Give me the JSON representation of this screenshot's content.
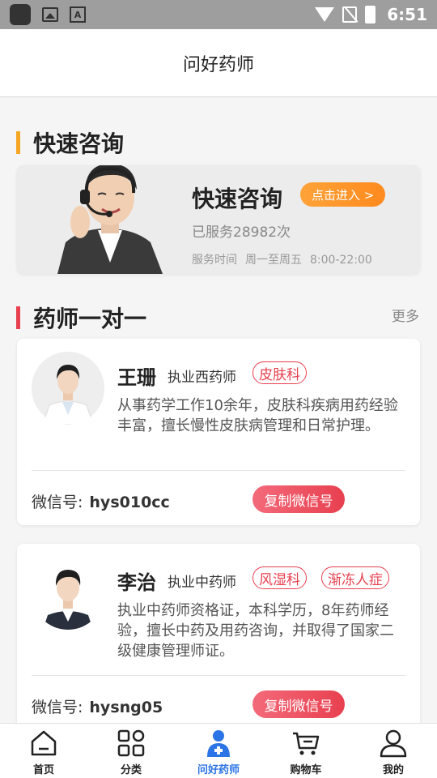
{
  "status_bar": {
    "time": "6:51",
    "a_icon": "A"
  },
  "header": {
    "title": "问好药师"
  },
  "quick_section": {
    "title": "快速咨询",
    "accent": "#f5a623"
  },
  "quick_card": {
    "title": "快速咨询",
    "enter_label": "点击进入 >",
    "served": "已服务28982次",
    "hours_label": "服务时间",
    "hours_days": "周一至周五",
    "hours_time": "8:00-22:00"
  },
  "pharm_section": {
    "title": "药师一对一",
    "more": "更多",
    "accent": "#e8404f"
  },
  "pharmacists": [
    {
      "name": "王珊",
      "title": "执业西药师",
      "tags": [
        "皮肤科"
      ],
      "desc": "从事药学工作10余年，皮肤科疾病用药经验丰富，擅长慢性皮肤病管理和日常护理。",
      "wechat_label": "微信号:",
      "wechat_id": "hys010cc",
      "copy_label": "复制微信号"
    },
    {
      "name": "李治",
      "title": "执业中药师",
      "tags": [
        "风湿科",
        "渐冻人症"
      ],
      "desc": "执业中药师资格证，本科学历，8年药师经验，擅长中药及用药咨询，并取得了国家二级健康管理师证。",
      "wechat_label": "微信号:",
      "wechat_id": "hysng05",
      "copy_label": "复制微信号"
    }
  ],
  "bottom_nav": [
    {
      "label": "首页",
      "icon": "home-icon"
    },
    {
      "label": "分类",
      "icon": "category-icon"
    },
    {
      "label": "问好药师",
      "icon": "pharmacist-icon",
      "active": true
    },
    {
      "label": "购物车",
      "icon": "cart-icon"
    },
    {
      "label": "我的",
      "icon": "user-icon"
    }
  ],
  "colors": {
    "active_nav": "#2b74e6",
    "tag": "#e8404f",
    "enter_btn": "#ff9a2e"
  }
}
